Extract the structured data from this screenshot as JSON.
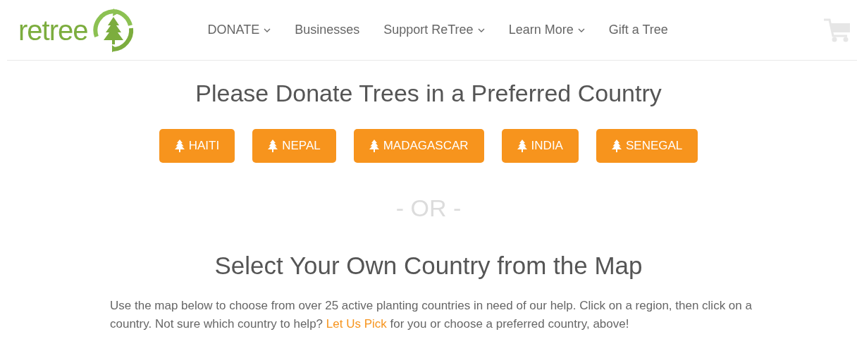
{
  "logo": {
    "text": "retree"
  },
  "nav": [
    {
      "label": "DONATE",
      "dropdown": true
    },
    {
      "label": "Businesses",
      "dropdown": false
    },
    {
      "label": "Support ReTree",
      "dropdown": true
    },
    {
      "label": "Learn More",
      "dropdown": true
    },
    {
      "label": "Gift a Tree",
      "dropdown": false
    }
  ],
  "heading": "Please Donate Trees in a Preferred Country",
  "country_buttons": [
    "HAITI",
    "NEPAL",
    "MADAGASCAR",
    "INDIA",
    "SENEGAL"
  ],
  "separator": "- OR -",
  "map_heading": "Select Your Own Country from the Map",
  "intro": {
    "before": "Use the map below to choose from over 25 active planting countries in need of our help. Click on a region, then click on a country. Not sure which country to help? ",
    "link": "Let Us Pick",
    "after": " for you or choose a preferred country, above!"
  }
}
